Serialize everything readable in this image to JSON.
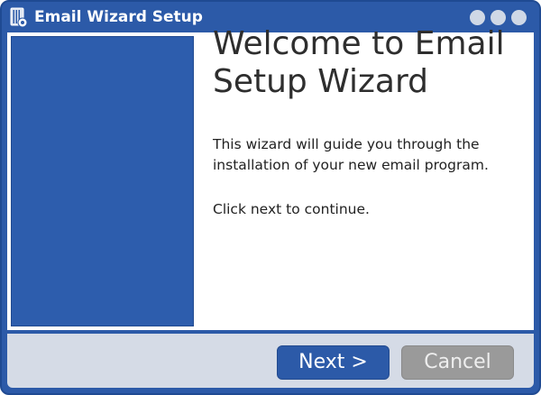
{
  "window": {
    "title": "Email Wizard Setup"
  },
  "titlebar_buttons": [
    "minimize",
    "maximize",
    "close"
  ],
  "main": {
    "heading": "Welcome to Email Setup Wizard",
    "paragraph_1": "This wizard will guide you through the installation of your new email program.",
    "paragraph_2": "Click next to continue."
  },
  "footer": {
    "next_label": "Next >",
    "cancel_label": "Cancel"
  },
  "colors": {
    "accent": "#2c5aa8",
    "side_panel": "#2d5dad",
    "footer_bg": "#d5dbe6",
    "disabled_button": "#9a9a9a"
  },
  "icons": {
    "app": "setup-package-icon"
  }
}
